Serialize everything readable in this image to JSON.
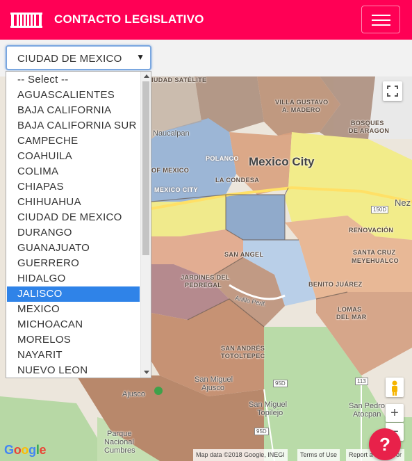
{
  "navbar": {
    "title": "CONTACTO LEGISLATIVO",
    "brand_icon": "building-columns-icon",
    "menu_icon": "hamburger-menu-icon",
    "color": "#ff0055"
  },
  "state_select": {
    "selected_value": "CIUDAD DE MEXICO",
    "highlighted_option": "JALISCO",
    "options": [
      "-- Select --",
      "AGUASCALIENTES",
      "BAJA CALIFORNIA",
      "BAJA CALIFORNIA SUR",
      "CAMPECHE",
      "COAHUILA",
      "COLIMA",
      "CHIAPAS",
      "CHIHUAHUA",
      "CIUDAD DE MEXICO",
      "DURANGO",
      "GUANAJUATO",
      "GUERRERO",
      "HIDALGO",
      "JALISCO",
      "MEXICO",
      "MICHOACAN",
      "MORELOS",
      "NAYARIT",
      "NUEVO LEON"
    ],
    "highlight_color": "#2f83e8"
  },
  "map": {
    "labels": {
      "ciudad_satelite": "IUDAD SATÉLITE",
      "villa_gustavo": "VILLA GUSTAVO",
      "a_madero": "A. MADERO",
      "bosques": "BOSQUES",
      "de_aragon": "DE ARAGON",
      "naucalpan": "Naucalpan",
      "polanco": "POLANCO",
      "mexico_city": "Mexico City",
      "la_condesa": "LA CONDESA",
      "of_mexico": "OF MEXICO",
      "mexico_city_small": "MEXICO CITY",
      "nez": "Nez",
      "renovacion": "RENOVACIÓN",
      "san_angel": "SAN ANGEL",
      "santa_cruz": "SANTA CRUZ",
      "meyehualco": "MEYEHUALCO",
      "jardines": "JARDINES DEL",
      "pedregal": "PEDREGAL",
      "benito_juarez": "BENITO JUÁREZ",
      "anillo_perif": "Anillo Perif.",
      "lomas": "LOMAS",
      "del_mar": "DEL MAR",
      "san_andres": "SAN ANDRÉS",
      "totoltepec": "TOTOLTEPEC",
      "san_miguel_ajusco_1": "San Miguel",
      "san_miguel_ajusco_2": "Ajusco",
      "ajusco": "Ajusco",
      "san_miguel_topilejo_1": "San Miguel",
      "san_miguel_topilejo_2": "Topilejo",
      "san_pedro_1": "San Pedro",
      "san_pedro_2": "Atocpan",
      "parque_1": "Parque",
      "parque_2": "Nacional",
      "parque_3": "Cumbres",
      "road_150d": "150D",
      "road_95d": "95D",
      "road_113": "113",
      "road_95d_b": "95D"
    },
    "google": "Google",
    "attribution": {
      "map_data": "Map data ©2018 Google, INEGI",
      "terms": "Terms of Use",
      "report": "Report a map error"
    },
    "controls": {
      "fullscreen_icon": "fullscreen-icon",
      "pegman_icon": "street-view-pegman-icon",
      "zoom_in": "+",
      "zoom_out": "−"
    }
  },
  "help_button": {
    "label": "?",
    "color": "#e8214a"
  }
}
